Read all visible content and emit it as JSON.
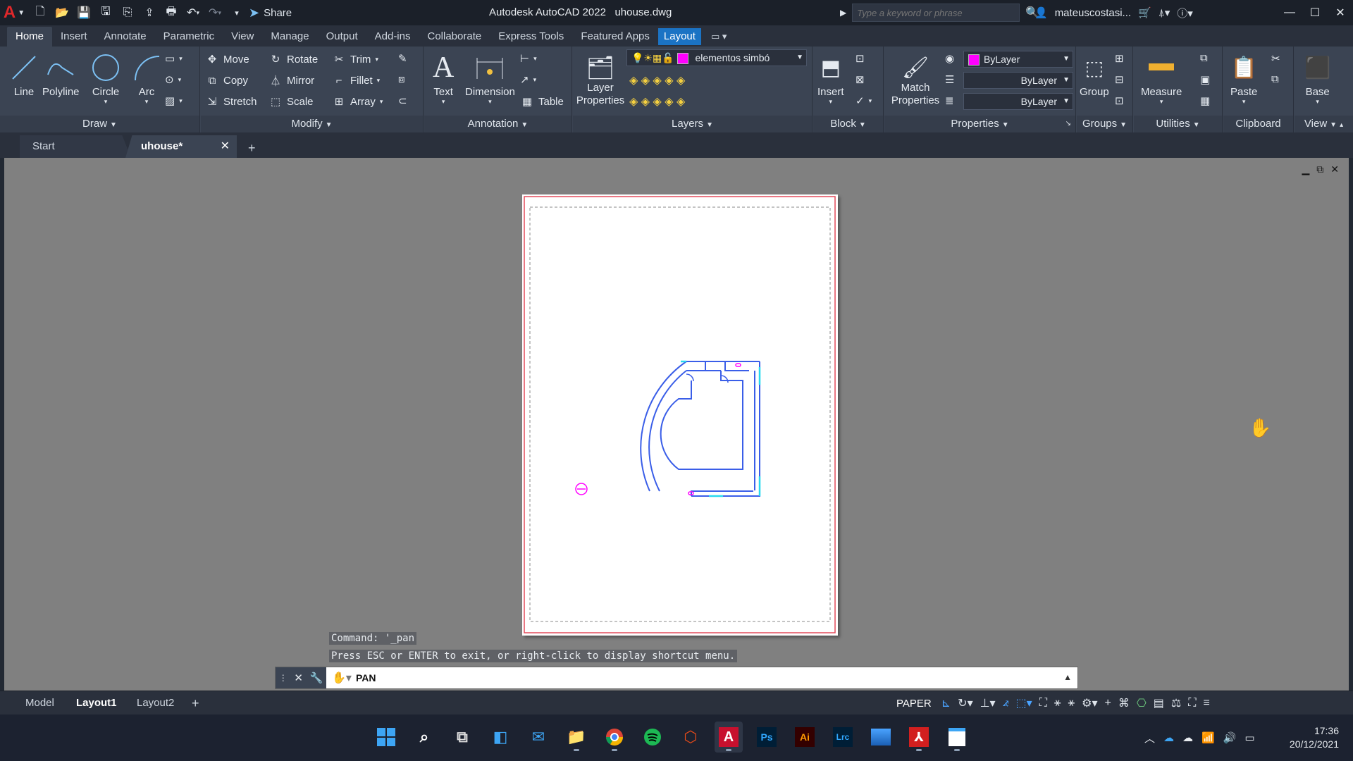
{
  "titlebar": {
    "app_title": "Autodesk AutoCAD 2022   uhouse.dwg",
    "share_label": "Share",
    "search_placeholder": "Type a keyword or phrase",
    "user_name": "mateuscostasi..."
  },
  "ribbon_tabs": [
    "Home",
    "Insert",
    "Annotate",
    "Parametric",
    "View",
    "Manage",
    "Output",
    "Add-ins",
    "Collaborate",
    "Express Tools",
    "Featured Apps",
    "Layout"
  ],
  "ribbon": {
    "draw": {
      "title": "Draw",
      "line": "Line",
      "polyline": "Polyline",
      "circle": "Circle",
      "arc": "Arc"
    },
    "modify": {
      "title": "Modify",
      "move": "Move",
      "rotate": "Rotate",
      "trim": "Trim",
      "copy": "Copy",
      "mirror": "Mirror",
      "fillet": "Fillet",
      "stretch": "Stretch",
      "scale": "Scale",
      "array": "Array"
    },
    "annotation": {
      "title": "Annotation",
      "text": "Text",
      "dimension": "Dimension",
      "table": "Table"
    },
    "layers": {
      "title": "Layers",
      "layer_properties": "Layer Properties",
      "current_layer": "elementos simbó"
    },
    "block": {
      "title": "Block",
      "insert": "Insert"
    },
    "properties": {
      "title": "Properties",
      "match_properties": "Match Properties",
      "color": "ByLayer",
      "linetype": "ByLayer",
      "lineweight": "ByLayer"
    },
    "groups": {
      "title": "Groups",
      "group": "Group"
    },
    "utilities": {
      "title": "Utilities",
      "measure": "Measure"
    },
    "clipboard": {
      "title": "Clipboard",
      "paste": "Paste"
    },
    "view": {
      "title": "View",
      "base": "Base"
    }
  },
  "doc_tabs": {
    "start": "Start",
    "current": "uhouse*"
  },
  "command": {
    "history_1": "Command: '_pan",
    "history_2": "Press ESC or ENTER to exit, or right-click to display shortcut menu.",
    "prompt": "PAN"
  },
  "layout_tabs": [
    "Model",
    "Layout1",
    "Layout2"
  ],
  "status": {
    "space": "PAPER"
  },
  "taskbar": {
    "apps": [
      "start",
      "search",
      "task-view",
      "widgets",
      "mail",
      "file-explorer",
      "chrome",
      "spotify",
      "office",
      "autocad",
      "photoshop",
      "illustrator",
      "lightroom-classic",
      "photos",
      "acrobat",
      "notepad"
    ],
    "ps_label": "Ps",
    "ai_label": "Ai",
    "lrc_label": "Lrc",
    "time": "17:36",
    "date": "20/12/2021"
  },
  "colors": {
    "accent": "#1b73c4",
    "drawing_lines": "#3a5ee8",
    "layer_color": "#ff00ff"
  }
}
